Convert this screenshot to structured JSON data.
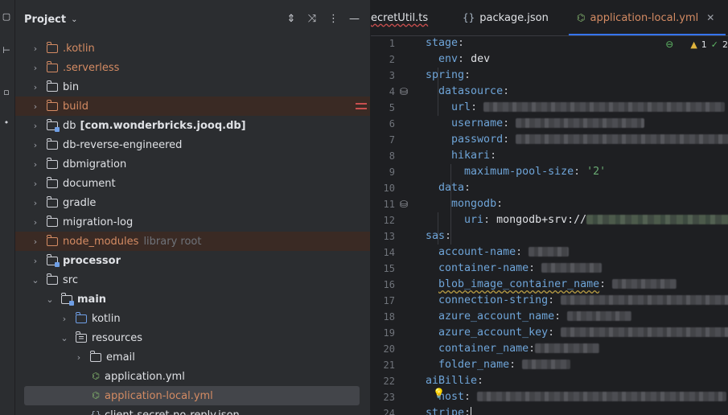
{
  "project": {
    "title": "Project",
    "tree": [
      {
        "label": "kotlin_hidden",
        "text": ".kotlin",
        "type": "folder",
        "indent": 1,
        "arrow": "right",
        "color": "orange"
      },
      {
        "text": ".serverless",
        "type": "folder",
        "indent": 1,
        "arrow": "right",
        "color": "orange"
      },
      {
        "text": "bin",
        "type": "folder",
        "indent": 1,
        "arrow": "right",
        "color": "default"
      },
      {
        "text": "build",
        "type": "folder",
        "indent": 1,
        "arrow": "right",
        "color": "orange",
        "excluded": true
      },
      {
        "text": "db",
        "suffix": "[com.wonderbricks.jooq.db]",
        "type": "module",
        "indent": 1,
        "arrow": "right"
      },
      {
        "text": "db-reverse-engineered",
        "type": "folder",
        "indent": 1,
        "arrow": "right",
        "color": "default"
      },
      {
        "text": "dbmigration",
        "type": "folder",
        "indent": 1,
        "arrow": "right",
        "color": "default"
      },
      {
        "text": "document",
        "type": "folder",
        "indent": 1,
        "arrow": "right",
        "color": "default"
      },
      {
        "text": "gradle",
        "type": "folder",
        "indent": 1,
        "arrow": "right",
        "color": "default"
      },
      {
        "text": "migration-log",
        "type": "folder",
        "indent": 1,
        "arrow": "right",
        "color": "default"
      },
      {
        "text": "node_modules",
        "tag": "library root",
        "type": "folder",
        "indent": 1,
        "arrow": "right",
        "color": "orange",
        "excluded": true
      },
      {
        "text": "processor",
        "type": "module",
        "indent": 1,
        "arrow": "right",
        "bold": true
      },
      {
        "text": "src",
        "type": "folder",
        "indent": 1,
        "arrow": "down",
        "color": "default"
      },
      {
        "text": "main",
        "type": "module",
        "indent": 2,
        "arrow": "down",
        "bold": true
      },
      {
        "text": "kotlin",
        "type": "folder",
        "indent": 3,
        "arrow": "right",
        "color": "blue"
      },
      {
        "text": "resources",
        "type": "res",
        "indent": 3,
        "arrow": "down"
      },
      {
        "text": "email",
        "type": "folder",
        "indent": 4,
        "arrow": "right",
        "color": "default"
      },
      {
        "text": "application.yml",
        "type": "yml",
        "indent": 4,
        "arrow": "none"
      },
      {
        "text": "application-local.yml",
        "type": "yml",
        "indent": 4,
        "arrow": "none",
        "selected": true,
        "orange": true
      },
      {
        "text": "client-secret-no-reply.json",
        "type": "json",
        "indent": 4,
        "arrow": "none"
      }
    ]
  },
  "tabs": [
    {
      "label": "ecretUtil.ts",
      "icon": "ts",
      "wavy": true
    },
    {
      "label": "package.json",
      "icon": "json"
    },
    {
      "label": "application-local.yml",
      "icon": "yml",
      "active": true
    }
  ],
  "inspections": {
    "warnings": "1",
    "checks": "2"
  },
  "code": [
    {
      "n": "1",
      "tokens": [
        {
          "c": "k",
          "t": "stage"
        },
        {
          "c": "p",
          "t": ":"
        }
      ]
    },
    {
      "n": "2",
      "tokens": [
        {
          "c": "v",
          "t": "  "
        },
        {
          "c": "k",
          "t": "env"
        },
        {
          "c": "p",
          "t": ": "
        },
        {
          "c": "v",
          "t": "dev"
        }
      ]
    },
    {
      "n": "3",
      "tokens": [
        {
          "c": "k",
          "t": "spring"
        },
        {
          "c": "p",
          "t": ":"
        }
      ]
    },
    {
      "n": "4",
      "tokens": [
        {
          "c": "v",
          "t": "  "
        },
        {
          "c": "k",
          "t": "datasource"
        },
        {
          "c": "p",
          "t": ":"
        }
      ],
      "icon": "db"
    },
    {
      "n": "5",
      "tokens": [
        {
          "c": "v",
          "t": "    "
        },
        {
          "c": "k",
          "t": "url"
        },
        {
          "c": "p",
          "t": ": "
        }
      ],
      "blur": 300
    },
    {
      "n": "6",
      "tokens": [
        {
          "c": "v",
          "t": "    "
        },
        {
          "c": "k",
          "t": "username"
        },
        {
          "c": "p",
          "t": ": "
        }
      ],
      "blur": 160
    },
    {
      "n": "7",
      "tokens": [
        {
          "c": "v",
          "t": "    "
        },
        {
          "c": "k",
          "t": "password"
        },
        {
          "c": "p",
          "t": ": "
        }
      ],
      "blur": 270
    },
    {
      "n": "8",
      "tokens": [
        {
          "c": "v",
          "t": "    "
        },
        {
          "c": "k",
          "t": "hikari"
        },
        {
          "c": "p",
          "t": ":"
        }
      ]
    },
    {
      "n": "9",
      "tokens": [
        {
          "c": "v",
          "t": "      "
        },
        {
          "c": "k",
          "t": "maximum-pool-size"
        },
        {
          "c": "p",
          "t": ": "
        },
        {
          "c": "s",
          "t": "'2'"
        }
      ]
    },
    {
      "n": "10",
      "tokens": [
        {
          "c": "v",
          "t": "  "
        },
        {
          "c": "k",
          "t": "data"
        },
        {
          "c": "p",
          "t": ":"
        }
      ]
    },
    {
      "n": "11",
      "tokens": [
        {
          "c": "v",
          "t": "    "
        },
        {
          "c": "k",
          "t": "mongodb"
        },
        {
          "c": "p",
          "t": ":"
        }
      ],
      "icon": "db"
    },
    {
      "n": "12",
      "tokens": [
        {
          "c": "v",
          "t": "      "
        },
        {
          "c": "k",
          "t": "uri"
        },
        {
          "c": "p",
          "t": ": "
        },
        {
          "c": "v",
          "t": "mongodb+srv://"
        }
      ],
      "blur": 200,
      "green": true
    },
    {
      "n": "13",
      "tokens": [
        {
          "c": "k",
          "t": "sas"
        },
        {
          "c": "p",
          "t": ":"
        }
      ]
    },
    {
      "n": "14",
      "tokens": [
        {
          "c": "v",
          "t": "  "
        },
        {
          "c": "k",
          "t": "account-name"
        },
        {
          "c": "p",
          "t": ": "
        }
      ],
      "blur": 50
    },
    {
      "n": "15",
      "tokens": [
        {
          "c": "v",
          "t": "  "
        },
        {
          "c": "k",
          "t": "container-name"
        },
        {
          "c": "p",
          "t": ": "
        }
      ],
      "blur": 75
    },
    {
      "n": "16",
      "tokens": [
        {
          "c": "v",
          "t": "  "
        },
        {
          "c": "kw",
          "t": "blob_image_container_name"
        },
        {
          "c": "p",
          "t": ": "
        }
      ],
      "blur": 80
    },
    {
      "n": "17",
      "tokens": [
        {
          "c": "v",
          "t": "  "
        },
        {
          "c": "k",
          "t": "connection-string"
        },
        {
          "c": "p",
          "t": ": "
        }
      ],
      "blur": 220
    },
    {
      "n": "18",
      "tokens": [
        {
          "c": "v",
          "t": "  "
        },
        {
          "c": "k",
          "t": "azure_account_name"
        },
        {
          "c": "p",
          "t": ": "
        }
      ],
      "blur": 80
    },
    {
      "n": "19",
      "tokens": [
        {
          "c": "v",
          "t": "  "
        },
        {
          "c": "k",
          "t": "azure_account_key"
        },
        {
          "c": "p",
          "t": ": "
        }
      ],
      "blur": 215
    },
    {
      "n": "20",
      "tokens": [
        {
          "c": "v",
          "t": "  "
        },
        {
          "c": "k",
          "t": "container_name"
        },
        {
          "c": "p",
          "t": ":"
        }
      ],
      "blur": 80
    },
    {
      "n": "21",
      "tokens": [
        {
          "c": "v",
          "t": "  "
        },
        {
          "c": "k",
          "t": "folder_name"
        },
        {
          "c": "p",
          "t": ": "
        }
      ],
      "blur": 60
    },
    {
      "n": "22",
      "tokens": [
        {
          "c": "k",
          "t": "aiBillie"
        },
        {
          "c": "p",
          "t": ":"
        }
      ]
    },
    {
      "n": "23",
      "tokens": [
        {
          "c": "v",
          "t": "  "
        },
        {
          "c": "k",
          "t": "host"
        },
        {
          "c": "p",
          "t": ": "
        }
      ],
      "blur": 310
    },
    {
      "n": "24",
      "tokens": [
        {
          "c": "k",
          "t": "stripe"
        },
        {
          "c": "p",
          "t": ":"
        }
      ],
      "cursor": true
    }
  ]
}
